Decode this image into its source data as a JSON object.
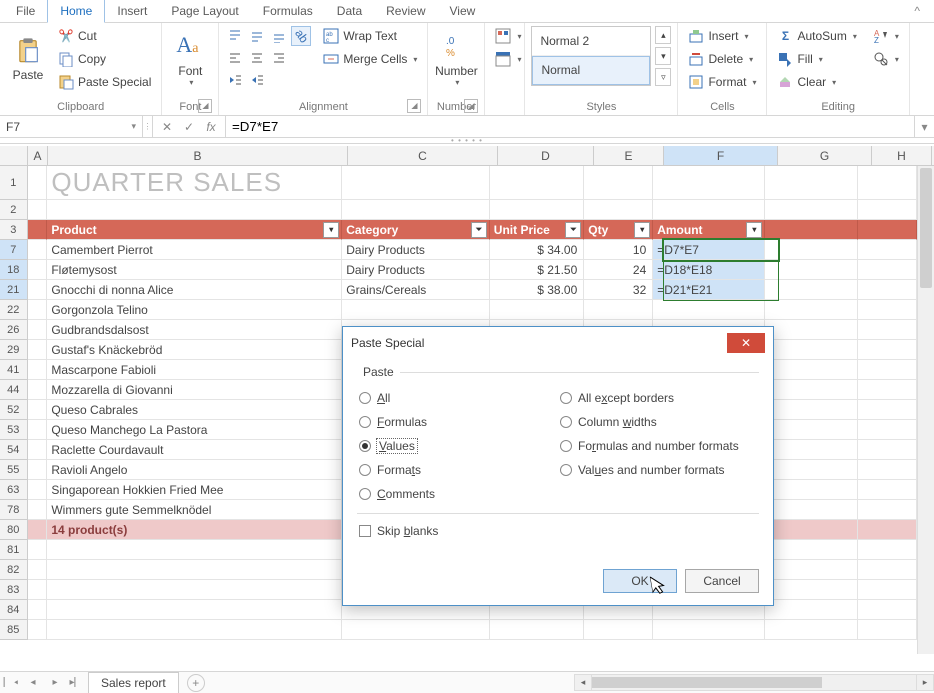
{
  "menu": {
    "tabs": [
      "File",
      "Home",
      "Insert",
      "Page Layout",
      "Formulas",
      "Data",
      "Review",
      "View"
    ],
    "active": "Home"
  },
  "ribbon": {
    "clipboard": {
      "label": "Clipboard",
      "paste": "Paste",
      "cut": "Cut",
      "copy": "Copy",
      "paste_special": "Paste Special"
    },
    "font": {
      "label": "Font",
      "btn": "Font"
    },
    "alignment": {
      "label": "Alignment",
      "wrap": "Wrap Text",
      "merge": "Merge Cells"
    },
    "number": {
      "label": "Number",
      "btn": "Number"
    },
    "styles": {
      "label": "Styles",
      "item1": "Normal 2",
      "item2": "Normal"
    },
    "cells": {
      "label": "Cells",
      "insert": "Insert",
      "delete": "Delete",
      "format": "Format"
    },
    "editing": {
      "label": "Editing",
      "autosum": "AutoSum",
      "fill": "Fill",
      "clear": "Clear"
    }
  },
  "formula_bar": {
    "name": "F7",
    "formula": "=D7*E7"
  },
  "columns": [
    "",
    "A",
    "B",
    "C",
    "D",
    "E",
    "F",
    "G",
    "H"
  ],
  "title": "QUARTER SALES",
  "headers": {
    "product": "Product",
    "category": "Category",
    "unit_price": "Unit Price",
    "qty": "Qty",
    "amount": "Amount"
  },
  "chart_data": {
    "type": "table",
    "columns": [
      "row",
      "Product",
      "Category",
      "Unit Price",
      "Qty",
      "Amount"
    ],
    "rows": [
      [
        7,
        "Camembert Pierrot",
        "Dairy Products",
        "$ 34.00",
        "10",
        "=D7*E7"
      ],
      [
        18,
        "Fløtemysost",
        "Dairy Products",
        "$ 21.50",
        "24",
        "=D18*E18"
      ],
      [
        21,
        "Gnocchi di nonna Alice",
        "Grains/Cereals",
        "$ 38.00",
        "32",
        "=D21*E21"
      ],
      [
        22,
        "Gorgonzola Telino",
        "",
        "",
        "",
        ""
      ],
      [
        26,
        "Gudbrandsdalsost",
        "",
        "",
        "",
        ""
      ],
      [
        29,
        "Gustaf's Knäckebröd",
        "",
        "",
        "",
        ""
      ],
      [
        41,
        "Mascarpone Fabioli",
        "",
        "",
        "",
        ""
      ],
      [
        44,
        "Mozzarella di Giovanni",
        "",
        "",
        "",
        ""
      ],
      [
        52,
        "Queso Cabrales",
        "",
        "",
        "",
        ""
      ],
      [
        53,
        "Queso Manchego La Pastora",
        "",
        "",
        "",
        ""
      ],
      [
        54,
        "Raclette Courdavault",
        "",
        "",
        "",
        ""
      ],
      [
        55,
        "Ravioli Angelo",
        "",
        "",
        "",
        ""
      ],
      [
        63,
        "Singaporean Hokkien Fried Mee",
        "",
        "",
        "",
        ""
      ],
      [
        78,
        "Wimmers gute Semmelknödel",
        "",
        "",
        "",
        ""
      ]
    ]
  },
  "summary": {
    "row": 80,
    "text": "14 product(s)"
  },
  "plain_rows": [
    81,
    82,
    83,
    84,
    85
  ],
  "sheet": {
    "name": "Sales report"
  },
  "dialog": {
    "title": "Paste Special",
    "group": "Paste",
    "options_left": [
      "All",
      "Formulas",
      "Values",
      "Formats",
      "Comments"
    ],
    "options_right": [
      "All except borders",
      "Column widths",
      "Formulas and number formats",
      "Values and number formats"
    ],
    "selected": "Values",
    "skip": "Skip blanks",
    "ok": "OK",
    "cancel": "Cancel"
  }
}
